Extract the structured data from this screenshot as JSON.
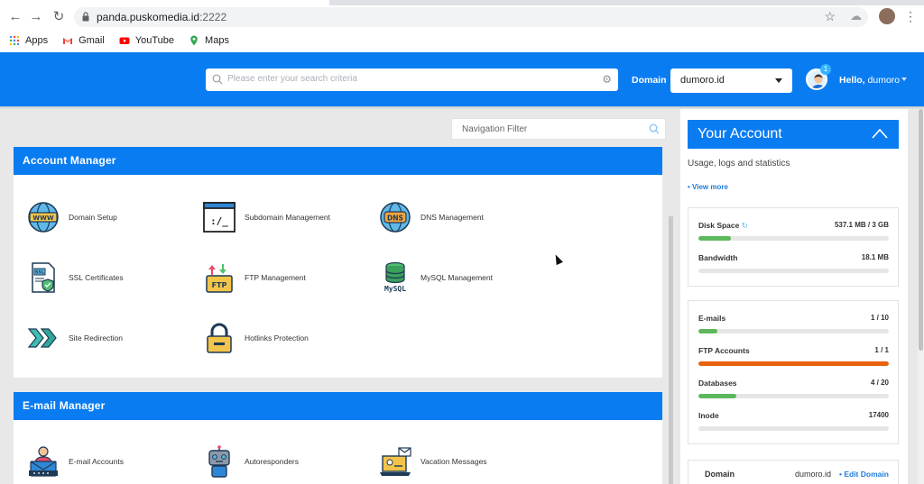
{
  "browser": {
    "url_host": "panda.puskomedia.id",
    "url_port": ":2222",
    "bookmarks": [
      {
        "label": "Apps",
        "icon": "apps-grid-icon"
      },
      {
        "label": "Gmail",
        "icon": "gmail-icon"
      },
      {
        "label": "YouTube",
        "icon": "youtube-icon"
      },
      {
        "label": "Maps",
        "icon": "maps-pin-icon"
      }
    ]
  },
  "header": {
    "search_placeholder": "Please enter your search criteria",
    "domain_label": "Domain",
    "domain_value": "dumoro.id",
    "notifications": "1",
    "hello": "Hello,",
    "username": "dumoro"
  },
  "nav_filter": {
    "placeholder": "Navigation Filter"
  },
  "account_manager": {
    "title": "Account Manager",
    "tools": [
      {
        "label": "Domain Setup",
        "icon": "www-globe-icon"
      },
      {
        "label": "Subdomain Management",
        "icon": "terminal-window-icon"
      },
      {
        "label": "DNS Management",
        "icon": "dns-globe-icon"
      },
      {
        "label": "SSL Certificates",
        "icon": "ssl-certificate-icon"
      },
      {
        "label": "FTP Management",
        "icon": "ftp-folder-icon"
      },
      {
        "label": "MySQL Management",
        "icon": "mysql-database-icon"
      },
      {
        "label": "Site Redirection",
        "icon": "redirect-arrows-icon"
      },
      {
        "label": "Hotlinks Protection",
        "icon": "padlock-icon"
      }
    ]
  },
  "email_manager": {
    "title": "E-mail Manager",
    "tools": [
      {
        "label": "E-mail Accounts",
        "icon": "email-user-icon"
      },
      {
        "label": "Autoresponders",
        "icon": "robot-icon"
      },
      {
        "label": "Vacation Messages",
        "icon": "vacation-laptop-icon"
      }
    ]
  },
  "your_account": {
    "title": "Your Account",
    "subtitle": "Usage, logs and statistics",
    "view_more": "• View more",
    "usage": [
      {
        "name": "Disk Space",
        "value": "537.1 MB / 3 GB",
        "fraction": 0.17,
        "color": "#5cb85c"
      },
      {
        "name": "Bandwidth",
        "value": "18.1 MB",
        "fraction": 0.0,
        "color": "#5cb85c"
      }
    ],
    "limits": [
      {
        "name": "E-mails",
        "value": "1 / 10",
        "fraction": 0.1,
        "color": "#5cb85c"
      },
      {
        "name": "FTP Accounts",
        "value": "1 / 1",
        "fraction": 1.0,
        "color": "#e8620c"
      },
      {
        "name": "Databases",
        "value": "4 / 20",
        "fraction": 0.2,
        "color": "#5cb85c"
      },
      {
        "name": "Inode",
        "value": "17400",
        "fraction": 0.0,
        "color": "#5cb85c"
      }
    ],
    "domain_row": {
      "key": "Domain",
      "value": "dumoro.id",
      "edit": "• Edit Domain"
    }
  },
  "colors": {
    "brand": "#0a7cf2",
    "ok": "#5cb85c",
    "full": "#e8620c",
    "link": "#1f7bd8"
  }
}
